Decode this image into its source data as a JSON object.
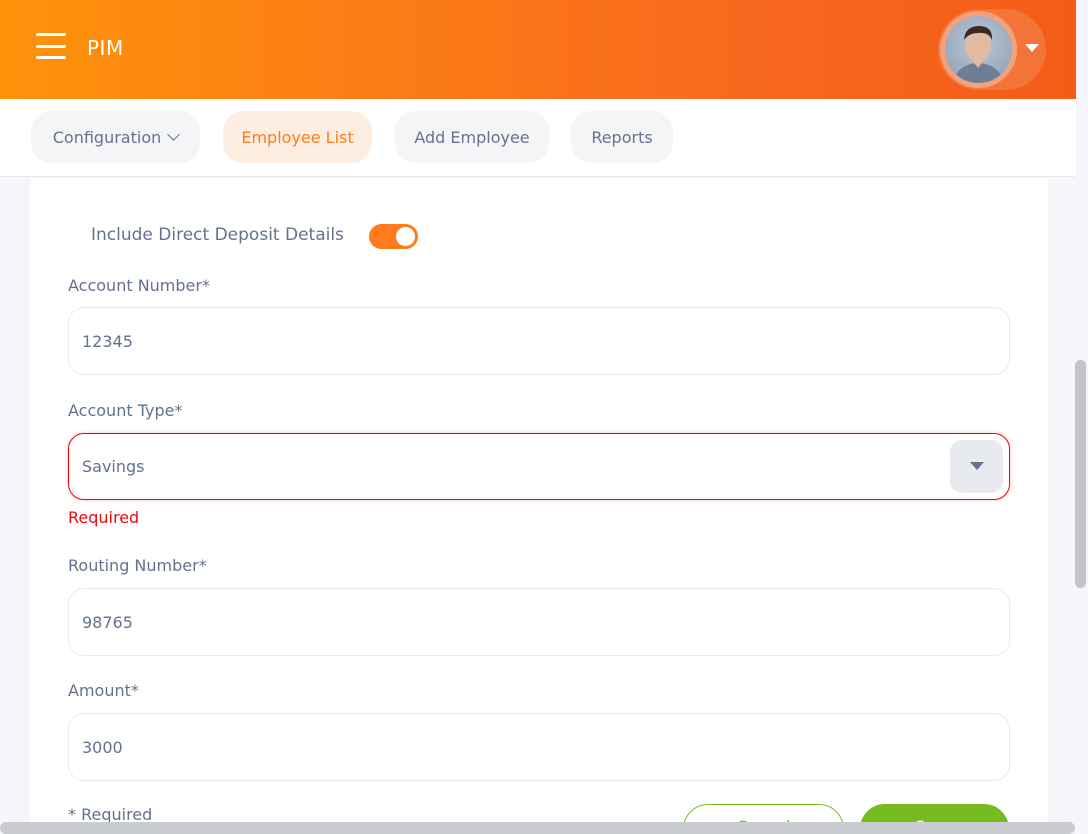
{
  "header": {
    "module_title": "PIM",
    "menu_icon": "hamburger-menu-icon",
    "user_menu_icon": "caret-down-icon"
  },
  "tabs": [
    {
      "label": "Configuration",
      "active": false,
      "has_dropdown": true
    },
    {
      "label": "Employee List",
      "active": true,
      "has_dropdown": false
    },
    {
      "label": "Add Employee",
      "active": false,
      "has_dropdown": false
    },
    {
      "label": "Reports",
      "active": false,
      "has_dropdown": false
    }
  ],
  "form": {
    "direct_deposit_toggle": {
      "label": "Include Direct Deposit Details",
      "on": true
    },
    "account_number": {
      "label": "Account Number*",
      "value": "12345"
    },
    "account_type": {
      "label": "Account Type*",
      "value": "Savings",
      "error": "Required"
    },
    "routing_number": {
      "label": "Routing Number*",
      "value": "98765"
    },
    "amount": {
      "label": "Amount*",
      "value": "3000"
    },
    "required_note": "* Required",
    "cancel_label": "Cancel",
    "save_label": "Save"
  },
  "colors": {
    "brand_orange": "#ff7b1d",
    "error_red": "#eb0910",
    "action_green": "#76bc21",
    "text_muted": "#64728c"
  }
}
